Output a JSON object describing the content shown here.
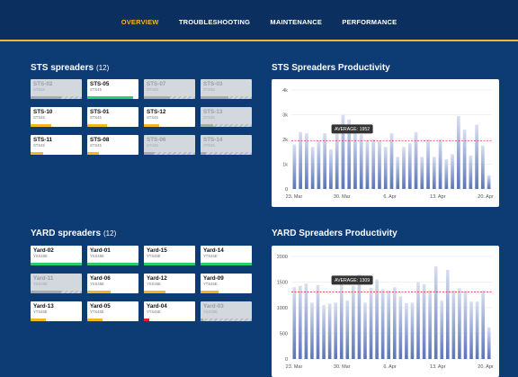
{
  "nav": {
    "items": [
      {
        "label": "OVERVIEW",
        "active": true
      },
      {
        "label": "TROUBLESHOOTING",
        "active": false
      },
      {
        "label": "MAINTENANCE",
        "active": false
      },
      {
        "label": "PERFORMANCE",
        "active": false
      }
    ]
  },
  "colors": {
    "accent": "#f2b825",
    "background": "#0d3b73",
    "green": "#2ecc71",
    "orange": "#f2b825",
    "red": "#e0202a",
    "gray": "#a7abb2"
  },
  "sts": {
    "title": "STS spreaders",
    "count": "(12)",
    "cards": [
      {
        "name": "STS-02",
        "type": "STS45",
        "dim": true,
        "color": "gray",
        "level": 0.6
      },
      {
        "name": "STS-05",
        "type": "STS45",
        "dim": false,
        "color": "green",
        "level": 0.9
      },
      {
        "name": "STS-07",
        "type": "STS45",
        "dim": true,
        "color": "gray",
        "level": 0.5
      },
      {
        "name": "STS-03",
        "type": "STS45",
        "dim": true,
        "color": "gray",
        "level": 0.55
      },
      {
        "name": "STS-10",
        "type": "STS45",
        "dim": false,
        "color": "orange",
        "level": 0.4
      },
      {
        "name": "STS-01",
        "type": "STS45",
        "dim": false,
        "color": "orange",
        "level": 0.38
      },
      {
        "name": "STS-12",
        "type": "STS45",
        "dim": false,
        "color": "orange",
        "level": 0.3
      },
      {
        "name": "STS-13",
        "type": "STS45",
        "dim": true,
        "color": "gray",
        "level": 0.25
      },
      {
        "name": "STS-11",
        "type": "STS45",
        "dim": false,
        "color": "orange",
        "level": 0.25
      },
      {
        "name": "STS-08",
        "type": "STS45",
        "dim": false,
        "color": "orange",
        "level": 0.22
      },
      {
        "name": "STS-06",
        "type": "STS45",
        "dim": true,
        "color": "gray",
        "level": 0.2
      },
      {
        "name": "STS-14",
        "type": "STS45",
        "dim": true,
        "color": "gray",
        "level": 0.1
      }
    ]
  },
  "yard": {
    "title": "YARD spreaders",
    "count": "(12)",
    "cards": [
      {
        "name": "Yard-02",
        "type": "YSS45E",
        "dim": false,
        "color": "green",
        "level": 1.0
      },
      {
        "name": "Yard-01",
        "type": "YSS45E",
        "dim": false,
        "color": "green",
        "level": 1.0
      },
      {
        "name": "Yard-15",
        "type": "YTS45E",
        "dim": false,
        "color": "green",
        "level": 1.0
      },
      {
        "name": "Yard-14",
        "type": "YTS45E",
        "dim": false,
        "color": "green",
        "level": 1.0
      },
      {
        "name": "Yard-11",
        "type": "YSS45E",
        "dim": true,
        "color": "gray",
        "level": 0.6
      },
      {
        "name": "Yard-06",
        "type": "YSS45E",
        "dim": false,
        "color": "orange",
        "level": 0.45
      },
      {
        "name": "Yard-12",
        "type": "YSS45E",
        "dim": false,
        "color": "orange",
        "level": 0.42
      },
      {
        "name": "Yard-09",
        "type": "YTS45E",
        "dim": false,
        "color": "orange",
        "level": 0.35
      },
      {
        "name": "Yard-13",
        "type": "YTS45E",
        "dim": false,
        "color": "orange",
        "level": 0.3
      },
      {
        "name": "Yard-05",
        "type": "YTS45E",
        "dim": false,
        "color": "orange",
        "level": 0.3
      },
      {
        "name": "Yard-04",
        "type": "YTS45E",
        "dim": false,
        "color": "red",
        "level": 0.1
      },
      {
        "name": "Yard-03",
        "type": "YSS45E",
        "dim": true,
        "color": "gray",
        "level": 0.05
      }
    ]
  },
  "chart_data": [
    {
      "type": "bar",
      "title": "STS Spreaders Productivity",
      "x_ticks": [
        "23. Mar",
        "30. Mar",
        "6. Apr",
        "13. Apr",
        "20. Apr"
      ],
      "y_ticks": [
        "0",
        "1k",
        "2k",
        "3k",
        "4k"
      ],
      "ylim": [
        0,
        4000
      ],
      "values": [
        1800,
        2300,
        2250,
        1700,
        1950,
        2250,
        1600,
        2250,
        3000,
        2800,
        2300,
        2200,
        1950,
        2000,
        1950,
        1700,
        2250,
        1300,
        1700,
        1850,
        2300,
        1300,
        2000,
        1300,
        2000,
        1200,
        1400,
        2950,
        2400,
        1350,
        2600,
        1750,
        550
      ],
      "average": 1952,
      "average_label": "AVERAGE: 1952",
      "grid": true
    },
    {
      "type": "bar",
      "title": "YARD Spreaders Productivity",
      "x_ticks": [
        "23. Mar",
        "30. Mar",
        "6. Apr",
        "13. Apr",
        "20. Apr"
      ],
      "y_ticks": [
        "0",
        "500",
        "1000",
        "1500",
        "2000"
      ],
      "ylim": [
        0,
        2000
      ],
      "values": [
        1400,
        1430,
        1470,
        1100,
        1440,
        1050,
        1080,
        1100,
        1450,
        1140,
        1430,
        1650,
        1100,
        1390,
        1550,
        1360,
        1340,
        1400,
        1220,
        1090,
        1100,
        1500,
        1460,
        1340,
        1810,
        1140,
        1740,
        1340,
        1380,
        1320,
        1120,
        1120,
        1330,
        620
      ],
      "average": 1309,
      "average_label": "AVERAGE: 1309",
      "grid": true
    }
  ]
}
